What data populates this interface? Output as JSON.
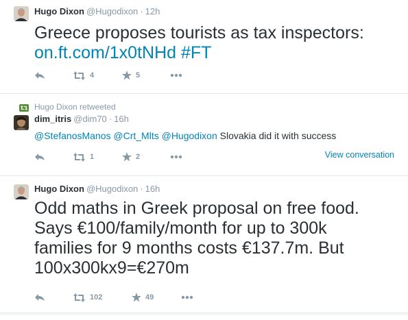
{
  "colors": {
    "link": "#0084b4",
    "muted": "#8899a6",
    "text": "#292f33",
    "retweet_green": "#5c913b",
    "divider": "#e1e8ed"
  },
  "tweets": [
    {
      "author": {
        "name": "Hugo Dixon",
        "handle": "@Hugodixon",
        "avatar_icon": "hugo-dixon-avatar"
      },
      "time": "12h",
      "text_plain": "Greece proposes tourists as tax inspectors:",
      "link_text": "on.ft.com/1x0tNHd",
      "hashtag": "#FT",
      "actions": {
        "reply_icon": "reply-icon",
        "retweet_icon": "retweet-icon",
        "favorite_icon": "star-icon",
        "more_icon": "more-icon",
        "retweets": "4",
        "favorites": "5"
      }
    },
    {
      "context": "Hugo Dixon retweeted",
      "context_icon": "retweet-badge-icon",
      "author": {
        "name": "dim_itris",
        "handle": "@dim70",
        "avatar_icon": "dim-itris-avatar"
      },
      "time": "16h",
      "mentions": [
        "@StefanosManos",
        "@Crt_Mlts",
        "@Hugodixon"
      ],
      "text_plain": "Slovakia did it with success",
      "view_conversation": "View conversation",
      "actions": {
        "retweets": "1",
        "favorites": "2"
      }
    },
    {
      "author": {
        "name": "Hugo Dixon",
        "handle": "@Hugodixon",
        "avatar_icon": "hugo-dixon-avatar"
      },
      "time": "16h",
      "text_lines": [
        "Odd maths in Greek proposal on free food.",
        "Says €100/family/month for up to 300k",
        "families for 9 months costs €137.7m. But",
        "100x300kx9=€270m"
      ],
      "actions": {
        "retweets": "102",
        "favorites": "49"
      }
    }
  ]
}
